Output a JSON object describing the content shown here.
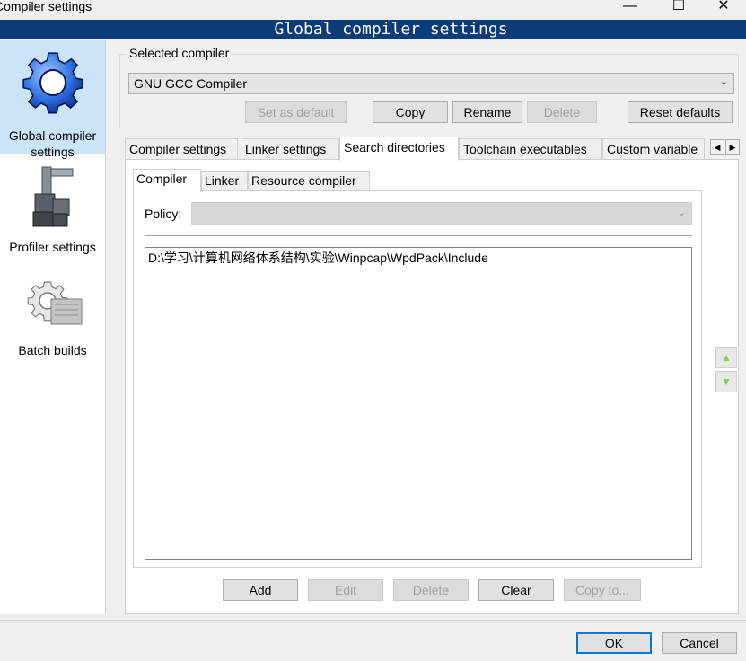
{
  "window": {
    "title": "Compiler settings",
    "minimize_glyph": "—",
    "maximize_glyph": "☐",
    "close_glyph": "✕"
  },
  "banner": "Global compiler settings",
  "sidebar": {
    "items": [
      {
        "label": "Global compiler settings",
        "icon": "gear-icon",
        "selected": true
      },
      {
        "label": "Profiler settings",
        "icon": "caliper-icon",
        "selected": false
      },
      {
        "label": "Batch builds",
        "icon": "gear-batch-icon",
        "selected": false
      }
    ]
  },
  "compiler_group": {
    "label": "Selected compiler",
    "selected_compiler": "GNU GCC Compiler",
    "buttons": {
      "set_default": "Set as default",
      "copy": "Copy",
      "rename": "Rename",
      "delete": "Delete",
      "reset_defaults": "Reset defaults"
    }
  },
  "tabs": [
    "Compiler settings",
    "Linker settings",
    "Search directories",
    "Toolchain executables",
    "Custom variable"
  ],
  "active_tab": "Search directories",
  "tab_scroll": {
    "left": "◀",
    "right": "▶"
  },
  "inner_tabs": [
    "Compiler",
    "Linker",
    "Resource compiler"
  ],
  "active_inner_tab": "Compiler",
  "policy": {
    "label": "Policy:",
    "value": ""
  },
  "directories": [
    "D:\\学习\\计算机网络体系结构\\实验\\Winpcap\\WpdPack\\Include"
  ],
  "side_buttons": {
    "up": "▲",
    "down": "▼"
  },
  "list_buttons": {
    "add": "Add",
    "edit": "Edit",
    "delete": "Delete",
    "clear": "Clear",
    "copy_to": "Copy to..."
  },
  "dialog_buttons": {
    "ok": "OK",
    "cancel": "Cancel"
  },
  "colors": {
    "banner_bg": "#0b3b78",
    "selected_item_bg": "#cce4f7",
    "arrow_button_green": "#7dcf55"
  }
}
